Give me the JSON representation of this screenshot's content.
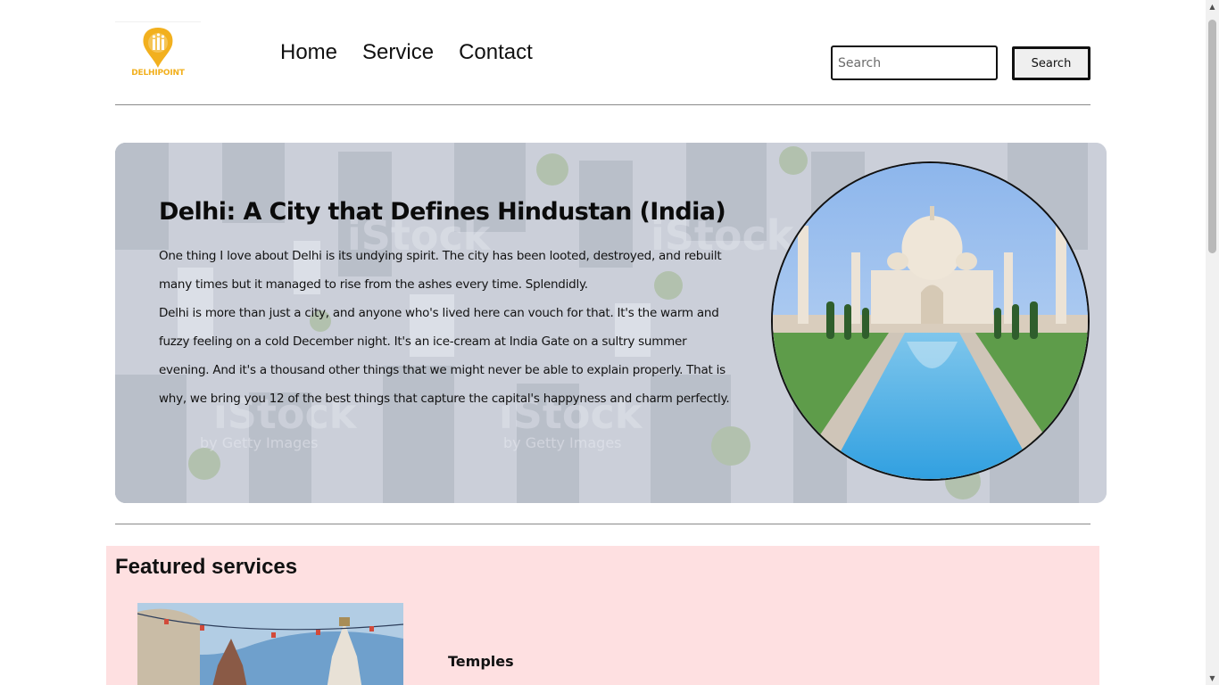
{
  "header": {
    "logo_text": "DELHIPOINT",
    "nav": [
      {
        "label": "Home"
      },
      {
        "label": "Service"
      },
      {
        "label": "Contact"
      }
    ],
    "search": {
      "placeholder": "Search",
      "value": "",
      "button_label": "Search"
    }
  },
  "hero": {
    "title": "Delhi: A City that Defines Hindustan (India)",
    "paragraphs": [
      "One thing I love about Delhi is its undying spirit. The city has been looted, destroyed, and rebuilt many times but it managed to rise from the ashes every time. Splendidly.",
      "Delhi is more than just a city, and anyone who's lived here can vouch for that. It's the warm and fuzzy feeling on a cold December night. It's an ice-cream at India Gate on a sultry summer evening. And it's a thousand other things that we might never be able to explain properly. That is why, we bring you 12 of the best things that capture the capital's happyness and charm perfectly."
    ],
    "watermark": {
      "brand": "iStock",
      "credit": "by Getty Images"
    }
  },
  "featured": {
    "title": "Featured services",
    "cards": [
      {
        "title": "Temples"
      }
    ]
  },
  "colors": {
    "logo_yellow": "#f2b01e",
    "featured_background": "#fee0e1",
    "rule": "#8a8a8a"
  }
}
